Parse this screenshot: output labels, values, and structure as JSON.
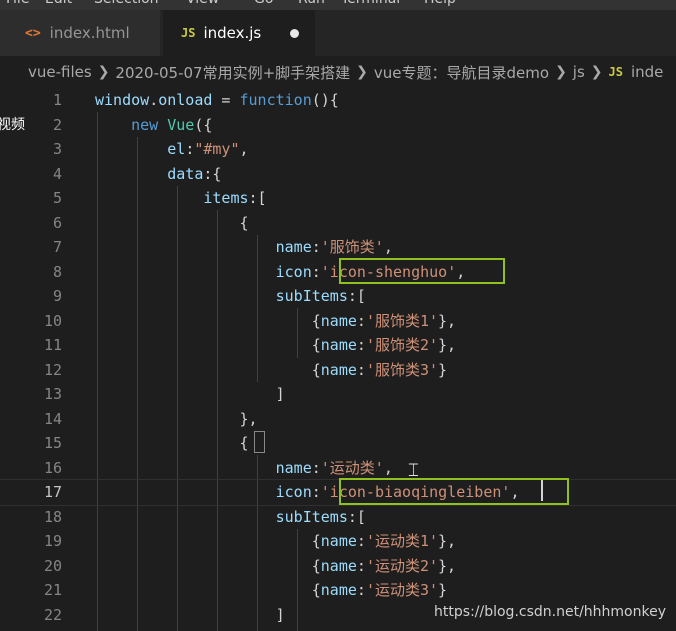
{
  "menubar": {
    "items": [
      "File",
      "Edit",
      "Selection",
      "View",
      "Go",
      "Run",
      "Terminal",
      "Help"
    ]
  },
  "tabs": [
    {
      "icon": "<>",
      "label": "index.html",
      "active": false
    },
    {
      "icon": "JS",
      "label": "index.js",
      "active": true,
      "dirty": true
    }
  ],
  "breadcrumb": {
    "items": [
      "vue-files",
      "2020-05-07常用实例+脚手架搭建",
      "vue专题：导航目录demo",
      "js"
    ],
    "file_icon": "JS",
    "file_label": "inde"
  },
  "side_text": "视频",
  "editor": {
    "lines": [
      {
        "n": "1",
        "tokens": [
          [
            "var",
            "window"
          ],
          [
            "pun",
            "."
          ],
          [
            "var",
            "onload"
          ],
          [
            "pun",
            " = "
          ],
          [
            "kw",
            "function"
          ],
          [
            "pun",
            "(){"
          ]
        ]
      },
      {
        "n": "2",
        "tokens": [
          [
            "pun",
            "    "
          ],
          [
            "kw",
            "new"
          ],
          [
            "pun",
            " "
          ],
          [
            "cls",
            "Vue"
          ],
          [
            "pun",
            "({"
          ]
        ]
      },
      {
        "n": "3",
        "tokens": [
          [
            "pun",
            "        "
          ],
          [
            "var",
            "el"
          ],
          [
            "pun",
            ":"
          ],
          [
            "str",
            "\"#my\""
          ],
          [
            "pun",
            ","
          ]
        ]
      },
      {
        "n": "4",
        "tokens": [
          [
            "pun",
            "        "
          ],
          [
            "var",
            "data"
          ],
          [
            "pun",
            ":{"
          ]
        ]
      },
      {
        "n": "5",
        "tokens": [
          [
            "pun",
            "            "
          ],
          [
            "var",
            "items"
          ],
          [
            "pun",
            ":["
          ]
        ]
      },
      {
        "n": "6",
        "tokens": [
          [
            "pun",
            "                {"
          ]
        ]
      },
      {
        "n": "7",
        "tokens": [
          [
            "pun",
            "                    "
          ],
          [
            "var",
            "name"
          ],
          [
            "pun",
            ":"
          ],
          [
            "str",
            "'服饰类'"
          ],
          [
            "pun",
            ","
          ]
        ]
      },
      {
        "n": "8",
        "tokens": [
          [
            "pun",
            "                    "
          ],
          [
            "var",
            "icon"
          ],
          [
            "pun",
            ":"
          ],
          [
            "str",
            "'icon-shenghuo'"
          ],
          [
            "pun",
            ","
          ]
        ]
      },
      {
        "n": "9",
        "tokens": [
          [
            "pun",
            "                    "
          ],
          [
            "var",
            "subItems"
          ],
          [
            "pun",
            ":["
          ]
        ]
      },
      {
        "n": "10",
        "tokens": [
          [
            "pun",
            "                        {"
          ],
          [
            "var",
            "name"
          ],
          [
            "pun",
            ":"
          ],
          [
            "str",
            "'服饰类1'"
          ],
          [
            "pun",
            "},"
          ]
        ]
      },
      {
        "n": "11",
        "tokens": [
          [
            "pun",
            "                        {"
          ],
          [
            "var",
            "name"
          ],
          [
            "pun",
            ":"
          ],
          [
            "str",
            "'服饰类2'"
          ],
          [
            "pun",
            "},"
          ]
        ]
      },
      {
        "n": "12",
        "tokens": [
          [
            "pun",
            "                        {"
          ],
          [
            "var",
            "name"
          ],
          [
            "pun",
            ":"
          ],
          [
            "str",
            "'服饰类3'"
          ],
          [
            "pun",
            "}"
          ]
        ]
      },
      {
        "n": "13",
        "tokens": [
          [
            "pun",
            "                    ]"
          ]
        ]
      },
      {
        "n": "14",
        "tokens": [
          [
            "pun",
            "                },"
          ]
        ]
      },
      {
        "n": "15",
        "tokens": [
          [
            "pun",
            "                {"
          ]
        ]
      },
      {
        "n": "16",
        "tokens": [
          [
            "pun",
            "                    "
          ],
          [
            "var",
            "name"
          ],
          [
            "pun",
            ":"
          ],
          [
            "str",
            "'运动类'"
          ],
          [
            "pun",
            ","
          ]
        ]
      },
      {
        "n": "17",
        "tokens": [
          [
            "pun",
            "                    "
          ],
          [
            "var",
            "icon"
          ],
          [
            "pun",
            ":"
          ],
          [
            "str",
            "'icon-biaoqingleiben'"
          ],
          [
            "pun",
            ","
          ]
        ]
      },
      {
        "n": "18",
        "tokens": [
          [
            "pun",
            "                    "
          ],
          [
            "var",
            "subItems"
          ],
          [
            "pun",
            ":["
          ]
        ]
      },
      {
        "n": "19",
        "tokens": [
          [
            "pun",
            "                        {"
          ],
          [
            "var",
            "name"
          ],
          [
            "pun",
            ":"
          ],
          [
            "str",
            "'运动类1'"
          ],
          [
            "pun",
            "},"
          ]
        ]
      },
      {
        "n": "20",
        "tokens": [
          [
            "pun",
            "                        {"
          ],
          [
            "var",
            "name"
          ],
          [
            "pun",
            ":"
          ],
          [
            "str",
            "'运动类2'"
          ],
          [
            "pun",
            "},"
          ]
        ]
      },
      {
        "n": "21",
        "tokens": [
          [
            "pun",
            "                        {"
          ],
          [
            "var",
            "name"
          ],
          [
            "pun",
            ":"
          ],
          [
            "str",
            "'运动类3'"
          ],
          [
            "pun",
            "}"
          ]
        ]
      },
      {
        "n": "22",
        "tokens": [
          [
            "pun",
            "                    ]"
          ]
        ]
      }
    ],
    "current_line": "17"
  },
  "colors": {
    "highlight_box": "#8fc21f",
    "keyword": "#569cd6",
    "variable": "#9cdcfe",
    "function": "#dcdcaa",
    "class": "#4ec9b0",
    "string": "#ce9178"
  },
  "watermark": "https://blog.csdn.net/hhhmonkey"
}
